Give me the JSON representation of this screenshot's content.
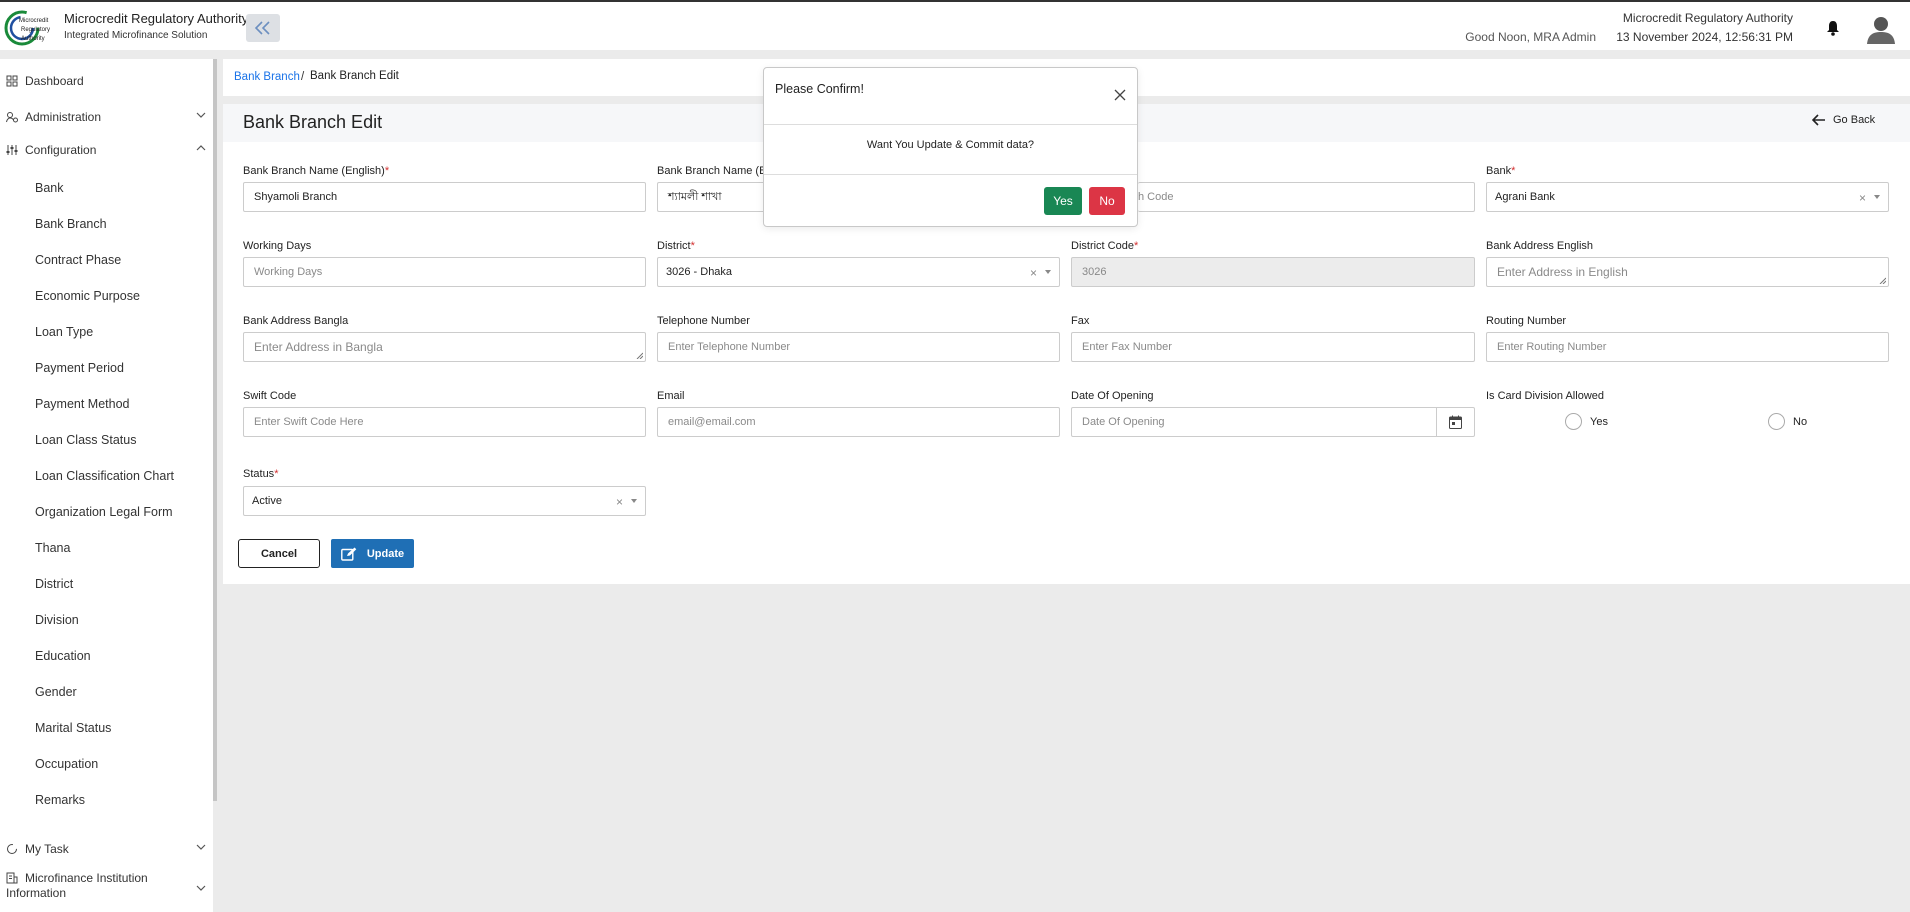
{
  "header": {
    "org_title": "Microcredit Regulatory Authority",
    "subtitle": "Integrated Microfinance Solution",
    "greeting": "Good Noon, MRA Admin",
    "org_name": "Microcredit Regulatory Authority",
    "datetime": "13 November 2024, 12:56:31 PM",
    "logo_text": [
      "Microcredit",
      "Regulatory",
      "Authority"
    ]
  },
  "sidebar": {
    "top_items": [
      {
        "label": "Dashboard",
        "icon": "grid-icon"
      },
      {
        "label": "Administration",
        "icon": "users-cog-icon"
      },
      {
        "label": "Configuration",
        "icon": "sliders-icon"
      }
    ],
    "config_items": [
      "Bank",
      "Bank Branch",
      "Contract Phase",
      "Economic Purpose",
      "Loan Type",
      "Payment Period",
      "Payment Method",
      "Loan Class Status",
      "Loan Classification Chart",
      "Organization Legal Form",
      "Thana",
      "District",
      "Division",
      "Education",
      "Gender",
      "Marital Status",
      "Occupation",
      "Remarks"
    ],
    "bottom_items": [
      {
        "label": "My Task",
        "icon": "refresh-icon"
      },
      {
        "label": "Microfinance Institution",
        "label2": "Information",
        "icon": "building-icon"
      }
    ]
  },
  "breadcrumb": {
    "link": "Bank Branch",
    "separator": "/",
    "current": "Bank Branch Edit"
  },
  "page": {
    "title": "Bank Branch Edit",
    "go_back": "Go Back"
  },
  "form": {
    "name_en": {
      "label": "Bank Branch Name (English)",
      "value": "Shyamoli Branch"
    },
    "name_bn": {
      "label": "Bank Branch Name (Ba",
      "value": "শ্যামলী শাখা"
    },
    "branch_code": {
      "placeholder": "h Code"
    },
    "bank": {
      "label": "Bank",
      "value": "Agrani Bank"
    },
    "working_days": {
      "label": "Working Days",
      "placeholder": "Working Days"
    },
    "district": {
      "label": "District",
      "value": "3026 - Dhaka"
    },
    "district_code": {
      "label": "District Code",
      "value": "3026"
    },
    "address_en": {
      "label": "Bank Address English",
      "placeholder": "Enter Address in English"
    },
    "address_bn": {
      "label": "Bank Address Bangla",
      "placeholder": "Enter Address in Bangla"
    },
    "telephone": {
      "label": "Telephone Number",
      "placeholder": "Enter Telephone Number"
    },
    "fax": {
      "label": "Fax",
      "placeholder": "Enter Fax Number"
    },
    "routing": {
      "label": "Routing Number",
      "placeholder": "Enter Routing Number"
    },
    "swift": {
      "label": "Swift Code",
      "placeholder": "Enter Swift Code Here"
    },
    "email": {
      "label": "Email",
      "placeholder": "email@email.com"
    },
    "opening_date": {
      "label": "Date Of Opening",
      "placeholder": "Date Of Opening"
    },
    "card_division": {
      "label": "Is Card Division Allowed",
      "yes": "Yes",
      "no": "No"
    },
    "status": {
      "label": "Status",
      "value": "Active"
    },
    "required_mark": "*",
    "clear_glyph": "×"
  },
  "actions": {
    "cancel": "Cancel",
    "update": "Update"
  },
  "modal": {
    "title": "Please Confirm!",
    "message": "Want You Update & Commit data?",
    "yes": "Yes",
    "no": "No"
  },
  "colors": {
    "link": "#1a73e8",
    "primary": "#1f6fb5",
    "success": "#198754",
    "danger": "#dc3545",
    "required": "#d32f2f"
  }
}
